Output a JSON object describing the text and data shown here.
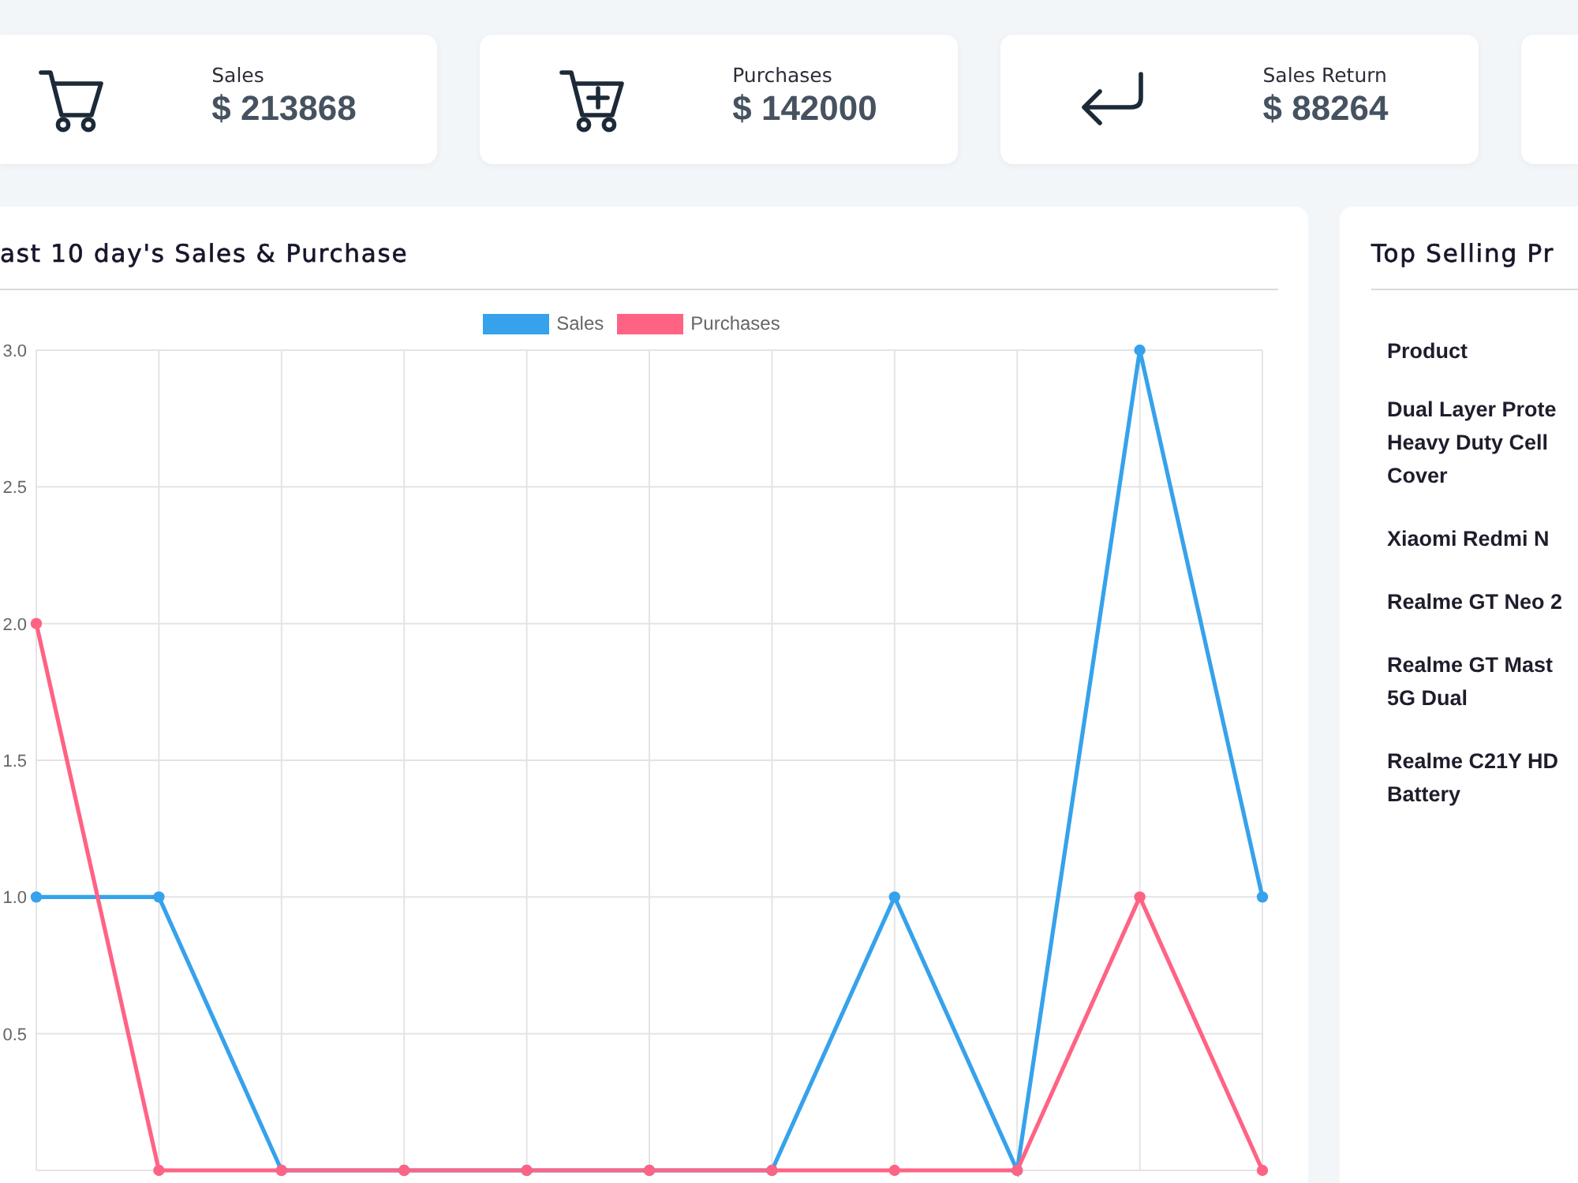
{
  "stat_cards": [
    {
      "kind": "sales",
      "label": "Sales",
      "value": "$ 213868"
    },
    {
      "kind": "purchases",
      "label": "Purchases",
      "value": "$ 142000"
    },
    {
      "kind": "returns",
      "label": "Sales Return",
      "value": "$ 88264"
    }
  ],
  "chart_panel": {
    "title": "ast 10 day's Sales & Purchase",
    "chart_data": {
      "type": "line",
      "series": [
        {
          "name": "Sales",
          "color": "#36a2eb",
          "marker": true,
          "values": [
            1,
            1,
            0,
            0,
            0,
            0,
            0,
            1,
            0,
            3,
            1
          ]
        },
        {
          "name": "Purchases",
          "color": "#ff6384",
          "marker": true,
          "values": [
            2,
            0,
            0,
            0,
            0,
            0,
            0,
            0,
            0,
            1,
            0
          ]
        }
      ],
      "ylim": [
        0,
        3
      ],
      "yticks": [
        0.5,
        {
          "value": 1,
          "label": "1.0"
        },
        1.5,
        {
          "value": 2,
          "label": "2.0"
        },
        2.5,
        {
          "value": 3,
          "label": "3.0"
        }
      ],
      "grid": true,
      "legend": true
    }
  },
  "top_selling": {
    "title": "Top Selling Pr",
    "columns": [
      "Product"
    ],
    "rows": [
      {
        "product": [
          "Dual Layer Prote",
          "Heavy Duty Cell",
          "Cover"
        ]
      },
      {
        "product": [
          "Xiaomi Redmi N"
        ]
      },
      {
        "product": [
          "Realme GT Neo 2"
        ]
      },
      {
        "product": [
          "Realme GT Mast",
          "5G Dual"
        ]
      },
      {
        "product": [
          "Realme C21Y HD",
          "Battery"
        ]
      }
    ]
  }
}
